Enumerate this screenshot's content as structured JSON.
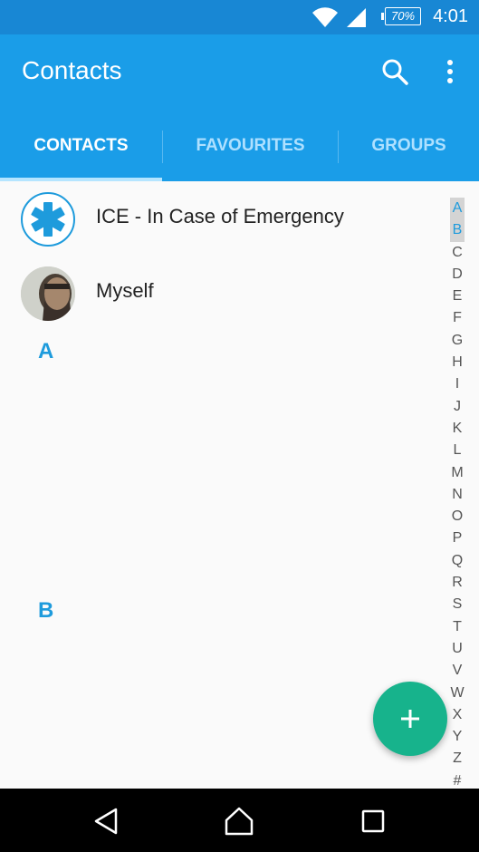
{
  "status_bar": {
    "battery": "70%",
    "time": "4:01"
  },
  "app_bar": {
    "title": "Contacts"
  },
  "tabs": [
    {
      "label": "CONTACTS"
    },
    {
      "label": "FAVOURITES"
    },
    {
      "label": "GROUPS"
    }
  ],
  "contacts": [
    {
      "name": "ICE - In Case of Emergency"
    },
    {
      "name": "Myself"
    }
  ],
  "sections": [
    "A",
    "B"
  ],
  "alphabet_index": [
    "A",
    "B",
    "C",
    "D",
    "E",
    "F",
    "G",
    "H",
    "I",
    "J",
    "K",
    "L",
    "M",
    "N",
    "O",
    "P",
    "Q",
    "R",
    "S",
    "T",
    "U",
    "V",
    "W",
    "X",
    "Y",
    "Z",
    "#"
  ],
  "colors": {
    "primary": "#1a9de8",
    "status_bar": "#1887d4",
    "accent": "#17b38c",
    "section_letter": "#1e9bdc"
  },
  "icons": [
    "wifi-icon",
    "signal-icon",
    "search-icon",
    "more-vert-icon",
    "star-of-life-icon",
    "plus-icon",
    "back-icon",
    "home-icon",
    "recents-icon"
  ]
}
